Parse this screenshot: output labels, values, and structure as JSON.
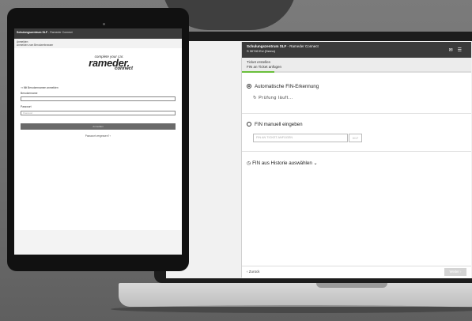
{
  "laptop_app": {
    "header": {
      "brand": "Schulungszentrum SLF",
      "title_suffix": " - Rameder Connect",
      "user_line": "S 30740 Evi (Demo)",
      "icons": [
        "bell-icon",
        "menu-icon"
      ]
    },
    "breadcrumb": {
      "title": "Ticket erstellen",
      "subtitle": "FIN an Ticket anfügen"
    },
    "progress_fraction": 0.14,
    "options": {
      "auto": {
        "label": "Automatische FIN-Erkennung",
        "status": "Prüfung läuft..."
      },
      "manual": {
        "label": "FIN manuell eingeben",
        "input_placeholder": "FIN AN TICKET ANFÜGEN",
        "button_label": "0/17"
      },
      "history": {
        "label": "FIN aus Historie auswählen"
      }
    },
    "footer": {
      "back_label": "‹ Zurück",
      "next_label": "Weiter ›"
    }
  },
  "tablet_app": {
    "header": {
      "brand": "Schulungszentrum SLF",
      "title_suffix": " - Rameder Connect"
    },
    "subheader": {
      "title": "Anmelden",
      "subtitle": "Anmelden zum Benutzerbrowser"
    },
    "logo": {
      "slogan": "complete your car.",
      "brand": "rameder.",
      "connect": "connect"
    },
    "login": {
      "intro": "Mit Benutzernamen anmelden",
      "username_label": "Benutzername",
      "username_value": "",
      "password_label": "Passwort",
      "password_placeholder": "Passwort",
      "submit_label": "Anmelden",
      "forgot_link": "Passwort vergessen? ›"
    }
  }
}
